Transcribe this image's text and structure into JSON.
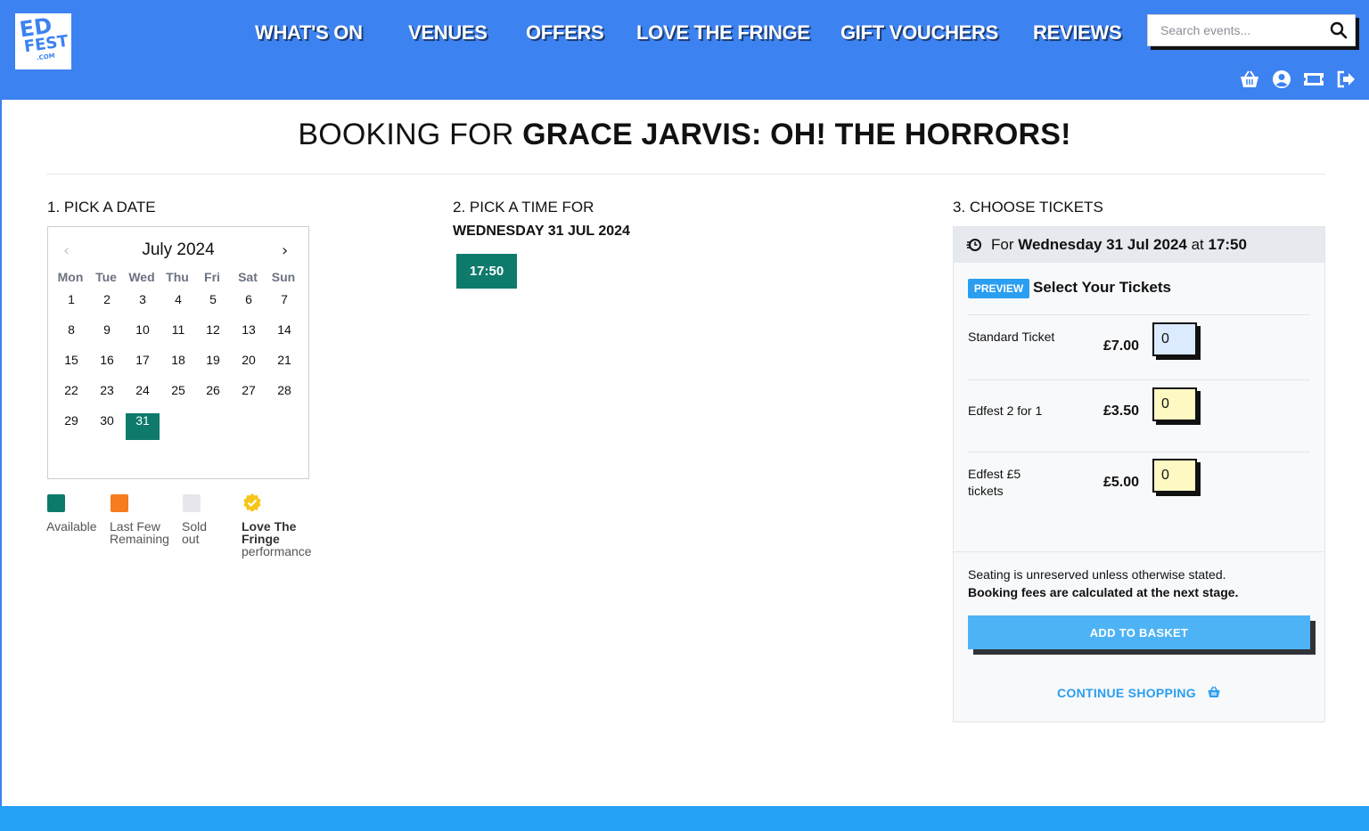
{
  "header": {
    "logo": {
      "line1": "ED",
      "line2": "FEST",
      "line3": ".COM"
    },
    "nav": [
      "WHAT'S ON",
      "VENUES",
      "OFFERS",
      "LOVE THE FRINGE",
      "GIFT VOUCHERS",
      "REVIEWS"
    ],
    "search_placeholder": "Search events...",
    "icons": [
      "basket-icon",
      "user-icon",
      "ticket-icon",
      "logout-icon"
    ],
    "color": "#3c82f0"
  },
  "title": {
    "prefix": "BOOKING FOR ",
    "show": "GRACE JARVIS: OH! THE HORRORS!"
  },
  "step1": {
    "label": "1. PICK A DATE",
    "calendar": {
      "month": "July 2024",
      "weekdays": [
        "Mon",
        "Tue",
        "Wed",
        "Thu",
        "Fri",
        "Sat",
        "Sun"
      ],
      "days": [
        1,
        2,
        3,
        4,
        5,
        6,
        7,
        8,
        9,
        10,
        11,
        12,
        13,
        14,
        15,
        16,
        17,
        18,
        19,
        20,
        21,
        22,
        23,
        24,
        25,
        26,
        27,
        28,
        29,
        30,
        31
      ],
      "selected_day": 31
    },
    "legend": [
      {
        "label": "Available",
        "color": "#0d7a6c"
      },
      {
        "label": "Last Few Remaining",
        "color": "#f57c1f"
      },
      {
        "label": "Sold out",
        "color": "#e5e7eb"
      },
      {
        "label_bold": "Love The Fringe",
        "label": "performance",
        "color": "#f5c518"
      }
    ]
  },
  "step2": {
    "label": "2. PICK A TIME FOR",
    "date": "WEDNESDAY 31 JUL 2024",
    "times": [
      "17:50"
    ]
  },
  "step3": {
    "label": "3. CHOOSE TICKETS",
    "for_prefix": "For ",
    "for_date": "Wednesday 31 Jul 2024",
    "for_at": " at ",
    "for_time": "17:50",
    "badge": "PREVIEW",
    "select_title": "Select Your Tickets",
    "tickets": [
      {
        "name": "Standard Ticket",
        "price": "£7.00",
        "qty": "0",
        "bg": "#dbeafe"
      },
      {
        "name": "Edfest 2 for 1",
        "price": "£3.50",
        "qty": "0",
        "bg": "#fef9c3"
      },
      {
        "name": "Edfest £5 tickets",
        "price": "£5.00",
        "qty": "0",
        "bg": "#fef9c3"
      }
    ],
    "note1": "Seating is unreserved unless otherwise stated.",
    "note2": "Booking fees are calculated at the next stage.",
    "add_button": "ADD TO BASKET",
    "continue": "CONTINUE SHOPPING"
  }
}
